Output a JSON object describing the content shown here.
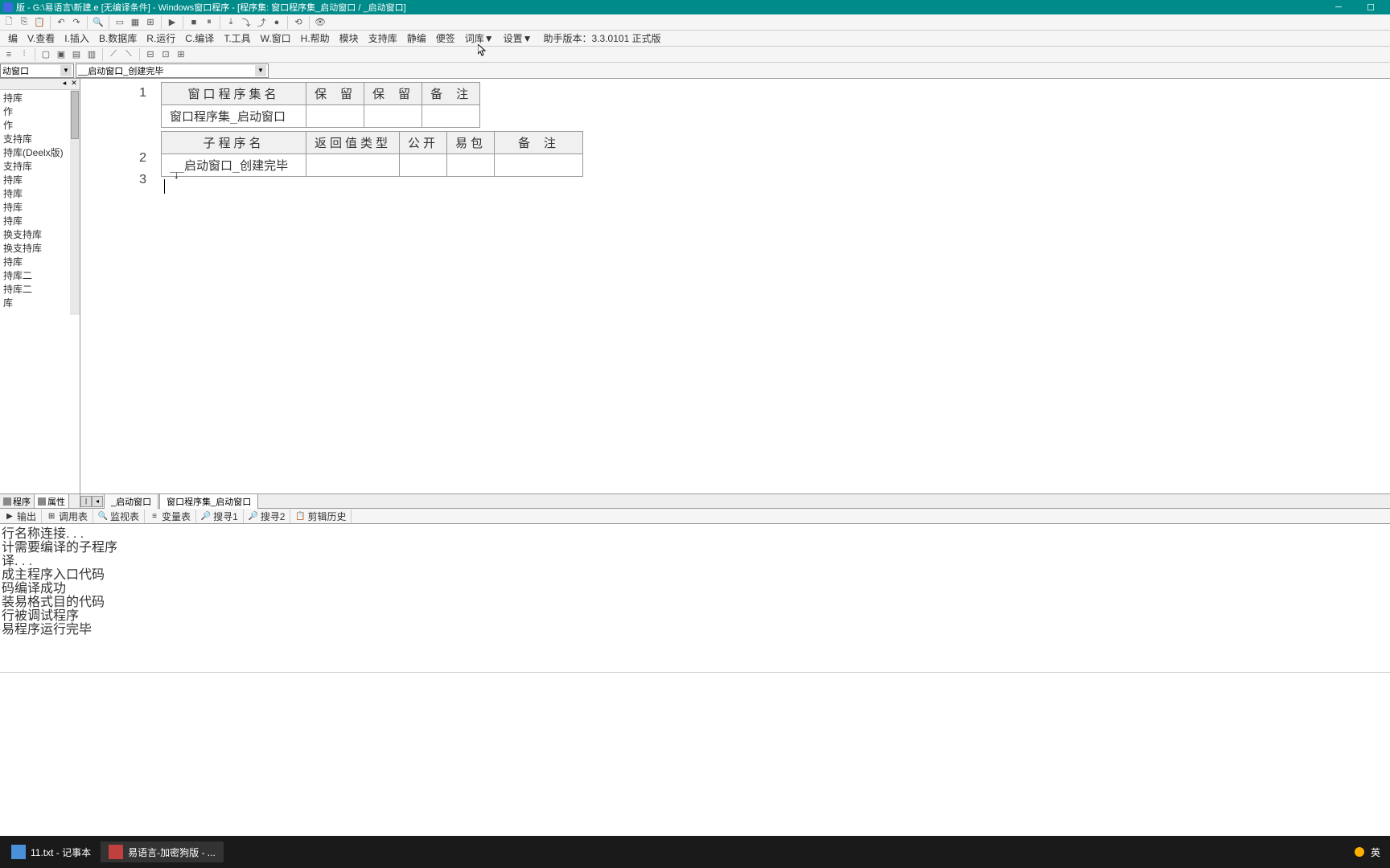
{
  "titlebar": {
    "text": "版 - G:\\易语言\\新建.e [无编译条件] - Windows窗口程序 - [程序集: 窗口程序集_启动窗口 / _启动窗口]"
  },
  "menu": {
    "items": [
      "编",
      "V.查看",
      "I.插入",
      "B.数据库",
      "R.运行",
      "C.编译",
      "T.工具",
      "W.窗口",
      "H.帮助",
      "模块",
      "支持库",
      "静编",
      "便签",
      "词库▼",
      "设置▼"
    ],
    "version_label": "助手版本：",
    "version": "3.3.0101 正式版"
  },
  "dropdowns": {
    "dd1": "动窗口",
    "dd2": "__启动窗口_创建完毕"
  },
  "tree": {
    "items": [
      "持库",
      "",
      "",
      "",
      "",
      "",
      "",
      "作",
      "",
      "",
      "",
      "",
      "",
      "",
      "",
      "",
      "作",
      "",
      "",
      "",
      "",
      "",
      "",
      "",
      "",
      "支持库",
      "持库(Deelx版)",
      "支持库",
      "持库",
      "持库",
      "",
      "",
      "持库",
      "",
      "持库",
      "换支持库",
      "换支持库",
      "持库",
      "持库二",
      "持库二",
      "库"
    ]
  },
  "left_tabs": {
    "tab1": "程序",
    "tab2": "属性"
  },
  "code": {
    "table1": {
      "h1": "窗口程序集名",
      "h2": "保 留",
      "h3": "保 留",
      "h4": "备 注",
      "r1c1": "窗口程序集_启动窗口"
    },
    "table2": {
      "h1": "子程序名",
      "h2": "返回值类型",
      "h3": "公开",
      "h4": "易包",
      "h5": "备 注",
      "r1c1": "__启动窗口_创建完毕"
    },
    "lines": [
      "1",
      "2",
      "3"
    ]
  },
  "editor_tabs": {
    "tab1": "_启动窗口",
    "tab2": "窗口程序集_启动窗口"
  },
  "bottom_tabs": {
    "tabs": [
      "输出",
      "调用表",
      "监视表",
      "变量表",
      "搜寻1",
      "搜寻2",
      "剪辑历史"
    ]
  },
  "output": {
    "lines": [
      "行名称连接. . .",
      "计需要编译的子程序",
      "译. . .",
      "成主程序入口代码",
      "码编译成功",
      "装易格式目的代码",
      "行被调试程序",
      "易程序运行完毕"
    ]
  },
  "taskbar": {
    "item1": "11.txt - 记事本",
    "item2": "易语言-加密狗版 - ...",
    "ime": "英"
  }
}
